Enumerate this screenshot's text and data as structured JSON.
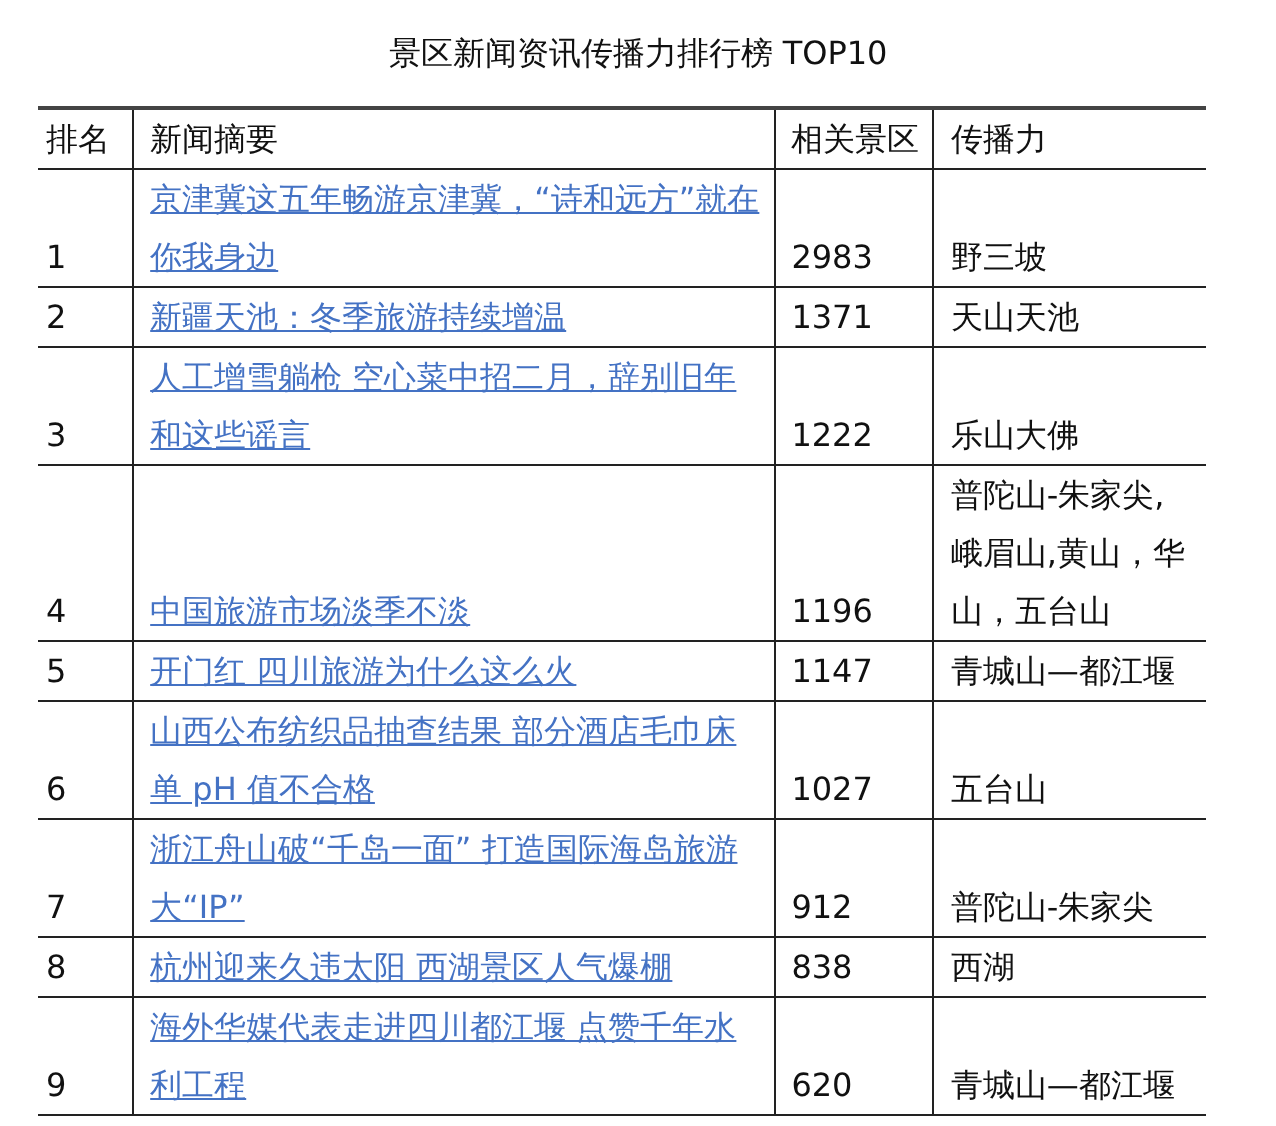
{
  "title": "景区新闻资讯传播力排行榜 TOP10",
  "table": {
    "columns": [
      "排名",
      "新闻摘要",
      "相关景区",
      "传播力"
    ],
    "rows": [
      {
        "rank": "1",
        "headline": "京津冀这五年畅游京津冀，“诗和远方”就在你我身边",
        "column_3": "2983",
        "column_4": "野三坡"
      },
      {
        "rank": "2",
        "headline": "新疆天池：冬季旅游持续增温",
        "column_3": "1371",
        "column_4": "天山天池"
      },
      {
        "rank": "3",
        "headline": "人工增雪躺枪 空心菜中招二月，辞别旧年和这些谣言",
        "column_3": "1222",
        "column_4": "乐山大佛"
      },
      {
        "rank": "4",
        "headline": "中国旅游市场淡季不淡",
        "column_3": "1196",
        "column_4": "普陀山-朱家尖,峨眉山,黄山，华山，五台山"
      },
      {
        "rank": "5",
        "headline": "开门红 四川旅游为什么这么火",
        "column_3": "1147",
        "column_4": "青城山—都江堰"
      },
      {
        "rank": "6",
        "headline": "山西公布纺织品抽查结果 部分酒店毛巾床单 pH 值不合格",
        "column_3": "1027",
        "column_4": "五台山"
      },
      {
        "rank": "7",
        "headline": "浙江舟山破“千岛一面”  打造国际海岛旅游大“IP”",
        "column_3": "912",
        "column_4": "普陀山-朱家尖"
      },
      {
        "rank": "8",
        "headline": "杭州迎来久违太阳 西湖景区人气爆棚",
        "column_3": "838",
        "column_4": "西湖"
      },
      {
        "rank": "9",
        "headline": "海外华媒代表走进四川都江堰 点赞千年水利工程",
        "column_3": "620",
        "column_4": "青城山—都江堰"
      }
    ]
  }
}
